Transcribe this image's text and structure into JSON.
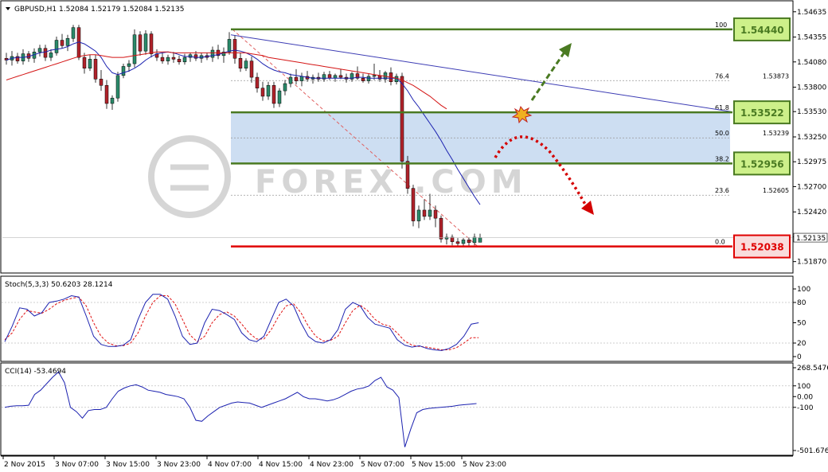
{
  "chart_data": [
    {
      "type": "candlestick",
      "title": "GBPUSD,H1  1.52084 1.52179 1.52084 1.52135",
      "symbol": "GBPUSD",
      "timeframe": "H1",
      "last_bar": {
        "open": 1.52084,
        "high": 1.52179,
        "low": 1.52084,
        "close": 1.52135
      },
      "current_price": "1.52135",
      "ylim": [
        1.5177,
        1.5473
      ],
      "y_ticks": [
        "1.54635",
        "1.54355",
        "1.54080",
        "1.53800",
        "1.53530",
        "1.53250",
        "1.52975",
        "1.52700",
        "1.52420",
        "1.52145",
        "1.51870"
      ],
      "x_ticks": [
        "2 Nov 2015",
        "3 Nov 07:00",
        "3 Nov 15:00",
        "3 Nov 23:00",
        "4 Nov 07:00",
        "4 Nov 15:00",
        "4 Nov 23:00",
        "5 Nov 07:00",
        "5 Nov 15:00",
        "5 Nov 23:00"
      ],
      "candles": [
        [
          1.5412,
          1.5418,
          1.5405,
          1.541
        ],
        [
          1.541,
          1.542,
          1.5404,
          1.5414
        ],
        [
          1.5414,
          1.5418,
          1.5406,
          1.5409
        ],
        [
          1.5409,
          1.5422,
          1.5405,
          1.5417
        ],
        [
          1.5417,
          1.542,
          1.5408,
          1.5412
        ],
        [
          1.5412,
          1.5423,
          1.5407,
          1.5419
        ],
        [
          1.5419,
          1.5427,
          1.5414,
          1.5423
        ],
        [
          1.5423,
          1.5427,
          1.5409,
          1.5413
        ],
        [
          1.5413,
          1.5422,
          1.5409,
          1.5418
        ],
        [
          1.5418,
          1.5436,
          1.5415,
          1.5432
        ],
        [
          1.5432,
          1.5439,
          1.5423,
          1.5426
        ],
        [
          1.5426,
          1.5438,
          1.542,
          1.5434
        ],
        [
          1.5434,
          1.5449,
          1.543,
          1.5446
        ],
        [
          1.5446,
          1.5449,
          1.541,
          1.5413
        ],
        [
          1.5413,
          1.5418,
          1.5395,
          1.5401
        ],
        [
          1.5401,
          1.5416,
          1.5398,
          1.5411
        ],
        [
          1.5411,
          1.5416,
          1.5385,
          1.5389
        ],
        [
          1.5389,
          1.5399,
          1.5376,
          1.5382
        ],
        [
          1.5382,
          1.5388,
          1.5356,
          1.5362
        ],
        [
          1.5362,
          1.5371,
          1.5355,
          1.5368
        ],
        [
          1.5368,
          1.5397,
          1.5364,
          1.5393
        ],
        [
          1.5393,
          1.5406,
          1.539,
          1.5403
        ],
        [
          1.5403,
          1.541,
          1.5397,
          1.5406
        ],
        [
          1.5406,
          1.5444,
          1.5402,
          1.5438
        ],
        [
          1.5438,
          1.5442,
          1.5415,
          1.542
        ],
        [
          1.542,
          1.5443,
          1.5416,
          1.5439
        ],
        [
          1.5439,
          1.5442,
          1.5413,
          1.5417
        ],
        [
          1.5417,
          1.5422,
          1.5409,
          1.5413
        ],
        [
          1.5413,
          1.5418,
          1.5406,
          1.5409
        ],
        [
          1.5409,
          1.5416,
          1.5405,
          1.5413
        ],
        [
          1.5413,
          1.5419,
          1.5407,
          1.5411
        ],
        [
          1.5411,
          1.5415,
          1.5405,
          1.5408
        ],
        [
          1.5408,
          1.5417,
          1.5405,
          1.5413
        ],
        [
          1.5413,
          1.5418,
          1.5408,
          1.5416
        ],
        [
          1.5416,
          1.542,
          1.5409,
          1.5412
        ],
        [
          1.5412,
          1.5418,
          1.5407,
          1.5415
        ],
        [
          1.5415,
          1.5418,
          1.541,
          1.5413
        ],
        [
          1.5413,
          1.5425,
          1.5408,
          1.5421
        ],
        [
          1.5421,
          1.5427,
          1.5411,
          1.5415
        ],
        [
          1.5415,
          1.5424,
          1.5407,
          1.5419
        ],
        [
          1.5419,
          1.5441,
          1.5416,
          1.5433
        ],
        [
          1.5433,
          1.5437,
          1.5406,
          1.5412
        ],
        [
          1.5412,
          1.5418,
          1.5397,
          1.5401
        ],
        [
          1.5401,
          1.5412,
          1.5398,
          1.5409
        ],
        [
          1.5409,
          1.5414,
          1.5385,
          1.5391
        ],
        [
          1.5391,
          1.5396,
          1.5374,
          1.5379
        ],
        [
          1.5379,
          1.5386,
          1.5365,
          1.537
        ],
        [
          1.537,
          1.5386,
          1.5366,
          1.5382
        ],
        [
          1.5382,
          1.5386,
          1.5357,
          1.5362
        ],
        [
          1.5362,
          1.5379,
          1.5358,
          1.5376
        ],
        [
          1.5376,
          1.5388,
          1.5371,
          1.5384
        ],
        [
          1.5384,
          1.5395,
          1.538,
          1.5391
        ],
        [
          1.5391,
          1.54,
          1.5383,
          1.5387
        ],
        [
          1.5387,
          1.5396,
          1.5381,
          1.5392
        ],
        [
          1.5392,
          1.5398,
          1.5386,
          1.5389
        ],
        [
          1.5389,
          1.5394,
          1.5384,
          1.5391
        ],
        [
          1.5391,
          1.5396,
          1.5386,
          1.5389
        ],
        [
          1.5389,
          1.5397,
          1.5386,
          1.5394
        ],
        [
          1.5394,
          1.5398,
          1.5388,
          1.539
        ],
        [
          1.539,
          1.5395,
          1.5386,
          1.5393
        ],
        [
          1.5393,
          1.54,
          1.5389,
          1.5391
        ],
        [
          1.5391,
          1.5395,
          1.5385,
          1.5389
        ],
        [
          1.5389,
          1.5397,
          1.5386,
          1.5395
        ],
        [
          1.5395,
          1.5403,
          1.5388,
          1.539
        ],
        [
          1.539,
          1.5395,
          1.5385,
          1.5387
        ],
        [
          1.5387,
          1.5395,
          1.5384,
          1.5392
        ],
        [
          1.5392,
          1.5406,
          1.5388,
          1.5393
        ],
        [
          1.5393,
          1.5399,
          1.5386,
          1.5389
        ],
        [
          1.5389,
          1.5398,
          1.5385,
          1.5396
        ],
        [
          1.5396,
          1.5402,
          1.5382,
          1.5386
        ],
        [
          1.5386,
          1.5395,
          1.5383,
          1.5392
        ],
        [
          1.5392,
          1.5396,
          1.529,
          1.5298
        ],
        [
          1.5298,
          1.5304,
          1.5262,
          1.5268
        ],
        [
          1.5268,
          1.5272,
          1.5226,
          1.5232
        ],
        [
          1.5232,
          1.5249,
          1.5224,
          1.5244
        ],
        [
          1.5244,
          1.5256,
          1.5233,
          1.5237
        ],
        [
          1.5237,
          1.5262,
          1.5233,
          1.5244
        ],
        [
          1.5244,
          1.5249,
          1.5225,
          1.5235
        ],
        [
          1.5235,
          1.5238,
          1.5208,
          1.5212
        ],
        [
          1.5212,
          1.5218,
          1.5206,
          1.5214
        ],
        [
          1.5214,
          1.5217,
          1.5205,
          1.5209
        ],
        [
          1.5209,
          1.5213,
          1.5204,
          1.5207
        ],
        [
          1.5207,
          1.5213,
          1.5204,
          1.5211
        ],
        [
          1.5211,
          1.5214,
          1.5204,
          1.5208
        ],
        [
          1.5208,
          1.5218,
          1.5205,
          1.5214
        ],
        [
          1.52084,
          1.52179,
          1.52084,
          1.52135
        ]
      ],
      "blue_ma": [
        1.541,
        1.5412,
        1.5413,
        1.5413,
        1.5414,
        1.5416,
        1.5418,
        1.5419,
        1.5421,
        1.5422,
        1.5423,
        1.5425,
        1.5428,
        1.543,
        1.5428,
        1.5424,
        1.542,
        1.5413,
        1.5403,
        1.5396,
        1.5394,
        1.5396,
        1.5398,
        1.5401,
        1.5405,
        1.541,
        1.5414,
        1.5417,
        1.5418,
        1.5419,
        1.5418,
        1.5416,
        1.5414,
        1.5414,
        1.5413,
        1.5413,
        1.5414,
        1.5415,
        1.5416,
        1.5418,
        1.542,
        1.5421,
        1.542,
        1.5418,
        1.5415,
        1.5411,
        1.5406,
        1.5402,
        1.5399,
        1.5397,
        1.5396,
        1.5394,
        1.5393,
        1.5392,
        1.5391,
        1.539,
        1.539,
        1.539,
        1.539,
        1.539,
        1.539,
        1.539,
        1.539,
        1.5391,
        1.5391,
        1.539,
        1.539,
        1.539,
        1.539,
        1.539,
        1.539,
        1.5384,
        1.5376,
        1.5366,
        1.5358,
        1.5349,
        1.534,
        1.5331,
        1.5321,
        1.531,
        1.53,
        1.5289,
        1.5279,
        1.5269,
        1.5259,
        1.525
      ],
      "red_ma": [
        1.5388,
        1.539,
        1.5392,
        1.5394,
        1.5396,
        1.5398,
        1.54,
        1.5402,
        1.5404,
        1.5406,
        1.5408,
        1.541,
        1.5412,
        1.5414,
        1.5415,
        1.5416,
        1.5416,
        1.5415,
        1.5414,
        1.5413,
        1.5413,
        1.5413,
        1.5414,
        1.5415,
        1.5416,
        1.5417,
        1.5418,
        1.5419,
        1.5419,
        1.5419,
        1.5418,
        1.5418,
        1.5418,
        1.5418,
        1.5418,
        1.5418,
        1.5418,
        1.5418,
        1.5418,
        1.5418,
        1.5418,
        1.5418,
        1.5418,
        1.5418,
        1.5417,
        1.5416,
        1.5415,
        1.5413,
        1.5412,
        1.5411,
        1.541,
        1.5409,
        1.5408,
        1.5407,
        1.5406,
        1.5405,
        1.5404,
        1.5403,
        1.5402,
        1.5401,
        1.54,
        1.5399,
        1.5398,
        1.5397,
        1.5396,
        1.5395,
        1.5394,
        1.5393,
        1.5392,
        1.5391,
        1.539,
        1.5388,
        1.5385,
        1.5382,
        1.5378,
        1.5374,
        1.537,
        1.5365,
        1.536,
        1.5356
      ],
      "fibonacci": [
        {
          "ratio": "100",
          "price": "1.54440"
        },
        {
          "ratio": "76.4",
          "price": "1.53873"
        },
        {
          "ratio": "61.8",
          "price": "1.53522"
        },
        {
          "ratio": "50.0",
          "price": "1.53239"
        },
        {
          "ratio": "38.2",
          "price": "1.52956"
        },
        {
          "ratio": "23.6",
          "price": "1.52605"
        },
        {
          "ratio": "0.0",
          "price": "1.52038"
        }
      ],
      "levels": [
        {
          "label": "1.54440",
          "value": 1.5444,
          "color": "#4a7a22",
          "fill": "#cdf08a"
        },
        {
          "label": "1.53522",
          "value": 1.53522,
          "color": "#4a7a22",
          "fill": "#cdf08a"
        },
        {
          "label": "1.52956",
          "value": 1.52956,
          "color": "#4a7a22",
          "fill": "#cdf08a"
        },
        {
          "label": "1.52038",
          "value": 1.52038,
          "color": "#e00000",
          "fill": "#f9dcdc"
        }
      ],
      "zone": {
        "from": 1.52956,
        "to": 1.53522,
        "color": "#bcd3ee"
      },
      "trendline": {
        "from": 1.5438,
        "to": 1.5353
      },
      "colors": {
        "bull": "#2a8a6a",
        "bear": "#b0222a",
        "blue_ma": "#1c22b0",
        "red_ma": "#d41414",
        "fib": "#999999",
        "up_arrow": "#4a7a22",
        "down_arrow": "#d40000"
      }
    },
    {
      "type": "line",
      "title": "Stoch(5,3,3) 50.6203 28.1214",
      "ylim": [
        0,
        100
      ],
      "y_ticks": [
        "100",
        "80",
        "50",
        "20",
        "0"
      ],
      "series": [
        {
          "name": "%K",
          "color": "#1c22b0",
          "values": [
            22,
            45,
            72,
            70,
            60,
            65,
            80,
            82,
            85,
            90,
            88,
            60,
            30,
            18,
            15,
            15,
            17,
            25,
            55,
            80,
            92,
            92,
            85,
            60,
            30,
            18,
            20,
            50,
            70,
            68,
            62,
            55,
            35,
            25,
            22,
            30,
            55,
            80,
            85,
            75,
            50,
            30,
            22,
            20,
            25,
            40,
            70,
            80,
            75,
            58,
            48,
            45,
            42,
            25,
            17,
            14,
            16,
            12,
            10,
            9,
            12,
            18,
            30,
            48,
            50
          ]
        },
        {
          "name": "%D",
          "color": "#e01010",
          "values": [
            25,
            35,
            55,
            68,
            66,
            64,
            70,
            78,
            83,
            86,
            88,
            75,
            50,
            30,
            20,
            16,
            16,
            20,
            35,
            60,
            80,
            90,
            90,
            78,
            55,
            32,
            22,
            30,
            50,
            62,
            66,
            60,
            48,
            35,
            26,
            26,
            40,
            60,
            75,
            78,
            65,
            45,
            30,
            23,
            24,
            30,
            50,
            68,
            76,
            68,
            55,
            48,
            45,
            35,
            23,
            17,
            15,
            14,
            12,
            10,
            10,
            13,
            20,
            28,
            28
          ]
        }
      ]
    },
    {
      "type": "line",
      "title": "CCI(14) -53.4694",
      "ylim": [
        -501.6769,
        268.5476
      ],
      "y_ticks": [
        "268.5476",
        "100",
        "0.00",
        "-100",
        "-501.6769"
      ],
      "series": [
        {
          "name": "CCI",
          "color": "#1c22b0",
          "values": [
            -100,
            -90,
            -85,
            -85,
            -80,
            20,
            60,
            120,
            180,
            230,
            130,
            -100,
            -140,
            -200,
            -130,
            -120,
            -120,
            -100,
            -20,
            50,
            80,
            100,
            110,
            90,
            60,
            50,
            40,
            20,
            10,
            0,
            -20,
            -100,
            -220,
            -230,
            -180,
            -140,
            -100,
            -80,
            -60,
            -50,
            -55,
            -60,
            -80,
            -100,
            -80,
            -60,
            -40,
            -20,
            10,
            40,
            0,
            -20,
            -20,
            -30,
            -40,
            -30,
            -10,
            20,
            50,
            70,
            80,
            100,
            150,
            180,
            90,
            60,
            -10,
            -470,
            -300,
            -150,
            -120,
            -110,
            -105,
            -100,
            -95,
            -90,
            -80,
            -75,
            -70,
            -65
          ]
        }
      ]
    }
  ],
  "colors": {
    "grid": "#d0d0d0",
    "border": "#000000",
    "watermark": "#8a8a8a"
  },
  "watermark_text": "FOREX   .COM"
}
